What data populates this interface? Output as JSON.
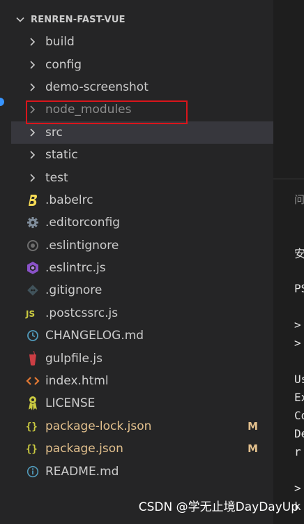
{
  "explorer": {
    "title": "RENREN-FAST-VUE",
    "items": [
      {
        "label": "build",
        "icon": "chevron-right-icon",
        "kind": "folder"
      },
      {
        "label": "config",
        "icon": "chevron-right-icon",
        "kind": "folder"
      },
      {
        "label": "demo-screenshot",
        "icon": "chevron-right-icon",
        "kind": "folder"
      },
      {
        "label": "node_modules",
        "icon": "chevron-right-icon",
        "kind": "folder",
        "dimmed": true,
        "highlighted": true
      },
      {
        "label": "src",
        "icon": "chevron-right-icon",
        "kind": "folder",
        "selected": true
      },
      {
        "label": "static",
        "icon": "chevron-right-icon",
        "kind": "folder"
      },
      {
        "label": "test",
        "icon": "chevron-right-icon",
        "kind": "folder"
      },
      {
        "label": ".babelrc",
        "icon": "babel-icon",
        "kind": "file"
      },
      {
        "label": ".editorconfig",
        "icon": "gear-icon",
        "kind": "file"
      },
      {
        "label": ".eslintignore",
        "icon": "eslint-ignore-icon",
        "kind": "file"
      },
      {
        "label": ".eslintrc.js",
        "icon": "eslint-icon",
        "kind": "file"
      },
      {
        "label": ".gitignore",
        "icon": "git-icon",
        "kind": "file"
      },
      {
        "label": ".postcssrc.js",
        "icon": "js-icon",
        "kind": "file"
      },
      {
        "label": "CHANGELOG.md",
        "icon": "clock-icon",
        "kind": "file"
      },
      {
        "label": "gulpfile.js",
        "icon": "gulp-icon",
        "kind": "file"
      },
      {
        "label": "index.html",
        "icon": "html-icon",
        "kind": "file"
      },
      {
        "label": "LICENSE",
        "icon": "license-icon",
        "kind": "file"
      },
      {
        "label": "package-lock.json",
        "icon": "json-icon",
        "kind": "file",
        "modified": true,
        "badge": "M"
      },
      {
        "label": "package.json",
        "icon": "json-icon",
        "kind": "file",
        "modified": true,
        "badge": "M"
      },
      {
        "label": "README.md",
        "icon": "info-icon",
        "kind": "file"
      }
    ]
  },
  "terminal": {
    "tab_label": "问",
    "lines": [
      "安",
      "PS",
      ">",
      ">",
      "Us",
      "Ex",
      "Co",
      "De",
      "r",
      ">",
      "k"
    ]
  },
  "watermark": "CSDN @学无止境DayDayUp",
  "colors": {
    "sidebar_bg": "#252526",
    "editor_bg": "#1e1e1e",
    "selected_row": "#37373d",
    "modified_text": "#e2c08d",
    "highlight_border": "#d9151b"
  }
}
